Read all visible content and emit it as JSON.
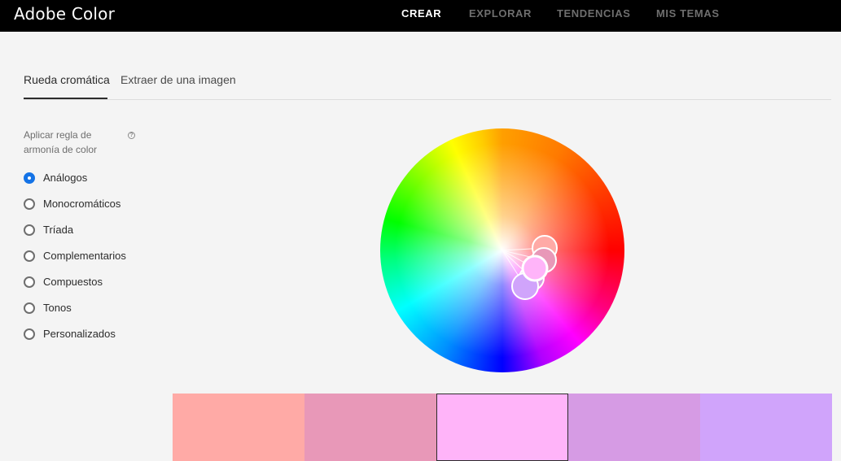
{
  "header": {
    "brand": "Adobe Color",
    "nav": [
      {
        "label": "CREAR",
        "active": true
      },
      {
        "label": "EXPLORAR",
        "active": false
      },
      {
        "label": "TENDENCIAS",
        "active": false
      },
      {
        "label": "MIS TEMAS",
        "active": false
      }
    ]
  },
  "tabs": [
    {
      "label": "Rueda cromática",
      "active": true
    },
    {
      "label": "Extraer de una imagen",
      "active": false
    }
  ],
  "harmony": {
    "label": "Aplicar regla de armonía de color",
    "help_icon": "question-circle-icon",
    "rules": [
      {
        "label": "Análogos",
        "checked": true
      },
      {
        "label": "Monocromáticos",
        "checked": false
      },
      {
        "label": "Tríada",
        "checked": false
      },
      {
        "label": "Complementarios",
        "checked": false
      },
      {
        "label": "Compuestos",
        "checked": false
      },
      {
        "label": "Tonos",
        "checked": false
      },
      {
        "label": "Personalizados",
        "checked": false
      }
    ]
  },
  "wheel": {
    "handles": [
      {
        "color": "#ffaaa6"
      },
      {
        "color": "#e898b8"
      },
      {
        "color": "#ffb4f9"
      },
      {
        "color": "#d69be4"
      },
      {
        "color": "#d0a4fb"
      }
    ]
  },
  "swatches": [
    {
      "color": "#ffaaa6",
      "selected": false
    },
    {
      "color": "#e898b8",
      "selected": false
    },
    {
      "color": "#ffb4f9",
      "selected": true
    },
    {
      "color": "#d69be4",
      "selected": false
    },
    {
      "color": "#d0a4fb",
      "selected": false
    }
  ]
}
